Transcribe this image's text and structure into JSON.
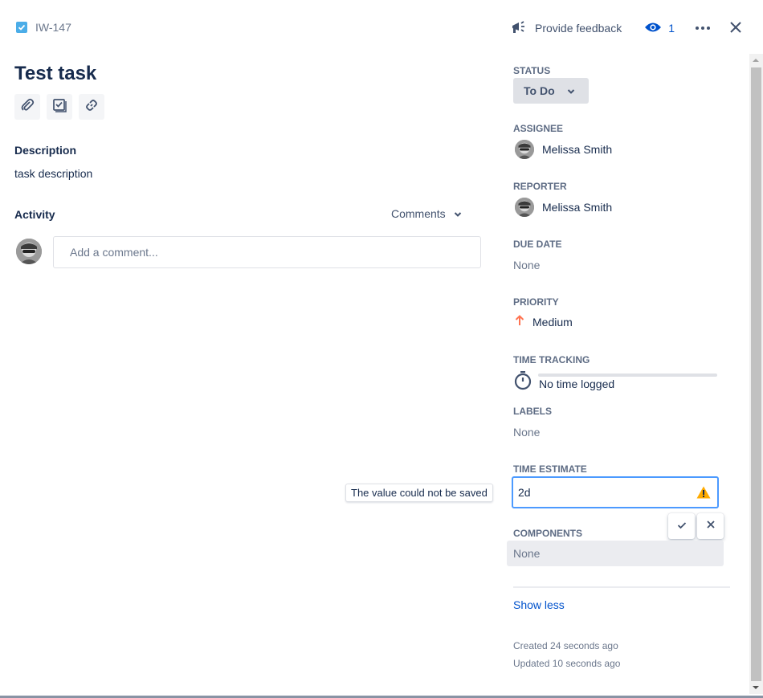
{
  "header": {
    "issue_key": "IW-147",
    "feedback_label": "Provide feedback",
    "watch_count": "1"
  },
  "issue": {
    "title": "Test task",
    "description_label": "Description",
    "description": "task description",
    "activity_label": "Activity",
    "activity_filter": "Comments",
    "comment_placeholder": "Add a comment..."
  },
  "fields": {
    "status_label": "STATUS",
    "status_value": "To Do",
    "assignee_label": "ASSIGNEE",
    "assignee_name": "Melissa Smith",
    "reporter_label": "REPORTER",
    "reporter_name": "Melissa Smith",
    "due_date_label": "DUE DATE",
    "due_date_value": "None",
    "priority_label": "PRIORITY",
    "priority_value": "Medium",
    "time_tracking_label": "TIME TRACKING",
    "time_tracking_value": "No time logged",
    "time_tracking_progress": 0,
    "labels_label": "LABELS",
    "labels_value": "None",
    "time_estimate_label": "TIME ESTIMATE",
    "time_estimate_value": "2d",
    "error_tooltip": "The value could not be saved",
    "components_label": "COMPONENTS",
    "components_value": "None"
  },
  "footer": {
    "show_less": "Show less",
    "created": "Created 24 seconds ago",
    "updated": "Updated 10 seconds ago"
  },
  "colors": {
    "accent": "#0052cc",
    "focus_border": "#4c9aff",
    "warning": "#ffab00",
    "priority_medium": "#ff7452",
    "issue_type": "#4bade8"
  },
  "icons": [
    "task-type-icon",
    "megaphone-icon",
    "eye-icon",
    "more-icon",
    "close-icon",
    "paperclip-icon",
    "checklist-icon",
    "link-icon",
    "chevron-down-icon",
    "stopwatch-icon",
    "arrow-up-icon",
    "warning-icon",
    "check-icon",
    "cancel-icon"
  ]
}
